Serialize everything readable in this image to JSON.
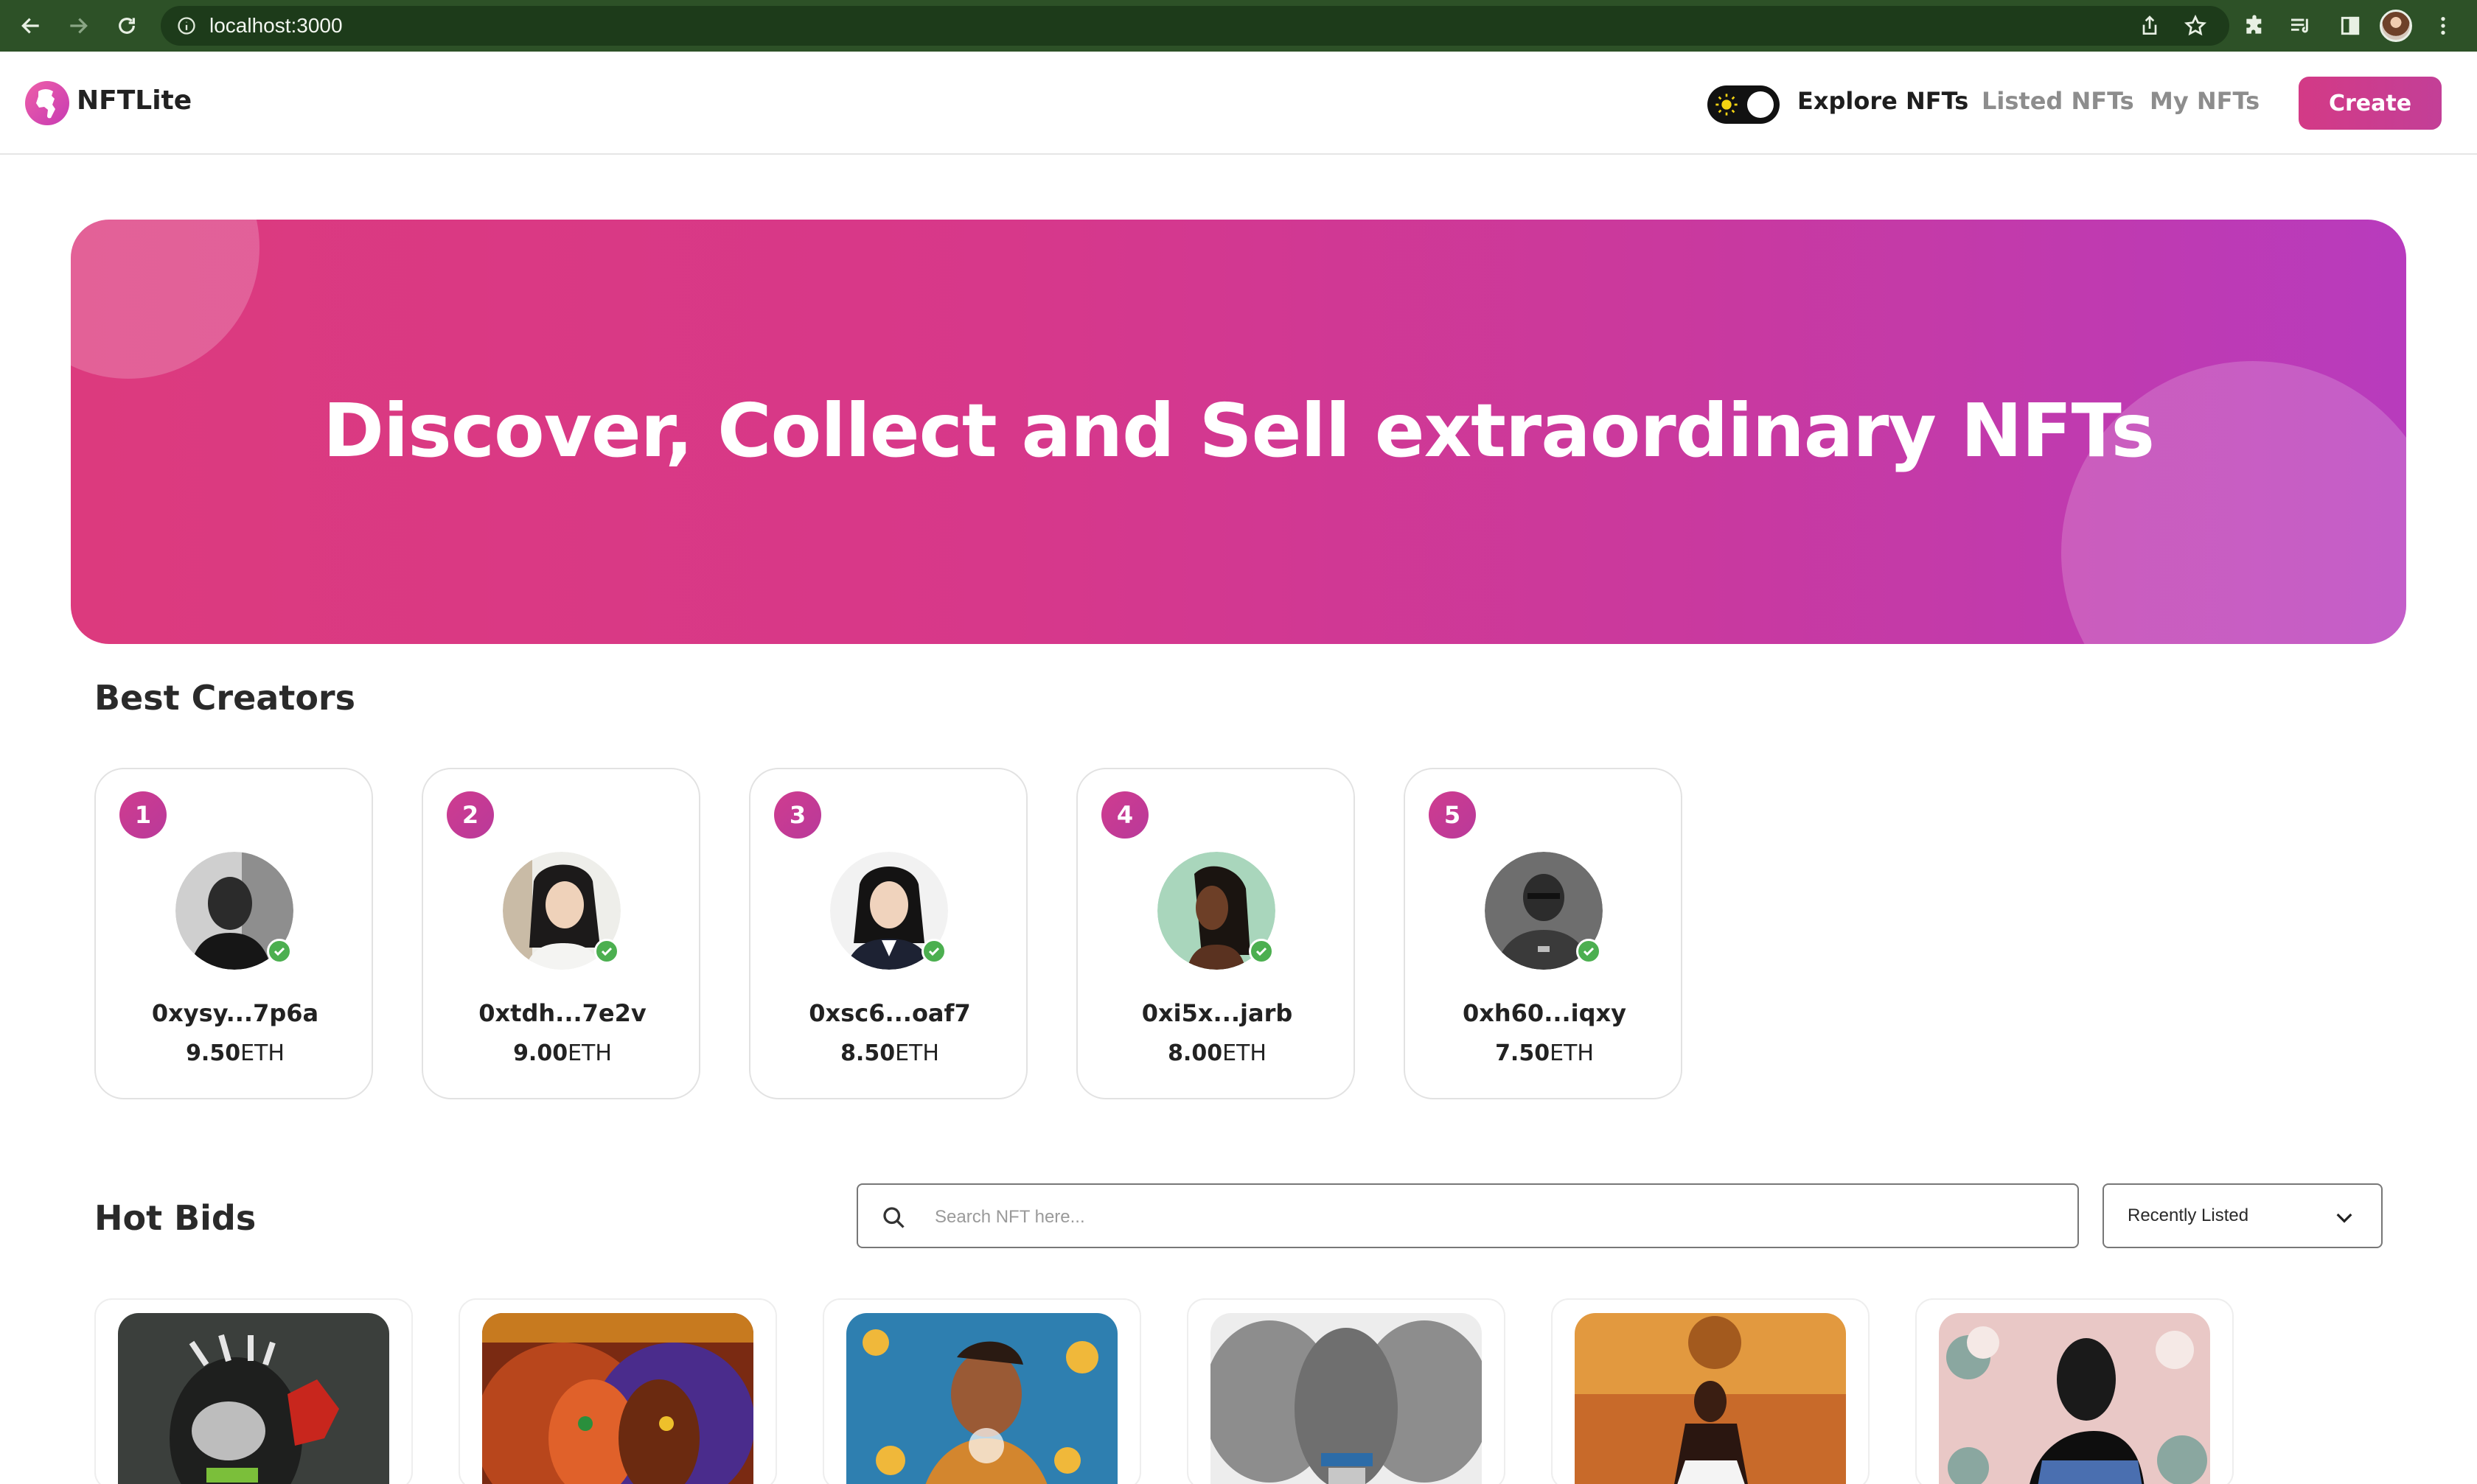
{
  "browser": {
    "url": "localhost:3000",
    "icons": {
      "back": "back-arrow-icon",
      "forward": "forward-arrow-icon",
      "reload": "reload-icon",
      "info": "info-icon",
      "share": "share-icon",
      "bookmark": "star-icon",
      "extensions": "puzzle-icon",
      "reading_list": "reading-list-icon",
      "side_panel": "side-panel-icon",
      "menu": "kebab-menu-icon"
    }
  },
  "navbar": {
    "brand": "NFTLite",
    "links": [
      "Explore NFTs",
      "Listed NFTs",
      "My NFTs"
    ],
    "active_link": "Explore NFTs",
    "create_label": "Create",
    "theme_toggle": "light"
  },
  "hero": {
    "title": "Discover, Collect and Sell extraordinary NFTs"
  },
  "creators": {
    "title": "Best Creators",
    "items": [
      {
        "rank": "1",
        "address": "0xysy...7p6a",
        "amount": "9.50",
        "unit": "ETH"
      },
      {
        "rank": "2",
        "address": "0xtdh...7e2v",
        "amount": "9.00",
        "unit": "ETH"
      },
      {
        "rank": "3",
        "address": "0xsc6...oaf7",
        "amount": "8.50",
        "unit": "ETH"
      },
      {
        "rank": "4",
        "address": "0xi5x...jarb",
        "amount": "8.00",
        "unit": "ETH"
      },
      {
        "rank": "5",
        "address": "0xh60...iqxy",
        "amount": "7.50",
        "unit": "ETH"
      }
    ]
  },
  "hot_bids": {
    "title": "Hot Bids",
    "search_placeholder": "Search NFT here...",
    "sort_selected": "Recently Listed"
  },
  "colors": {
    "accent": "#d13a8c",
    "hero_start": "#dc3a7e",
    "hero_end": "#b83bbd",
    "verified": "#4caf50",
    "chrome": "#2d5127"
  }
}
